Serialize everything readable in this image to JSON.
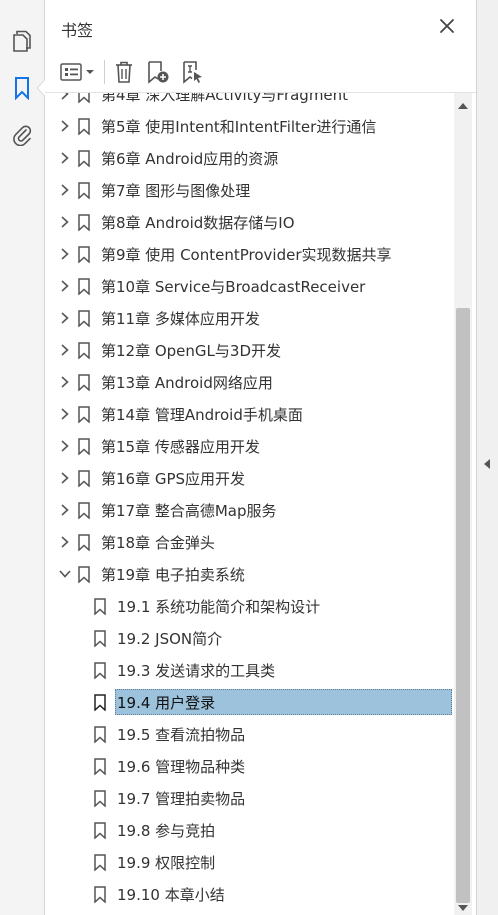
{
  "panel": {
    "title": "书签",
    "close_icon": "close-icon"
  },
  "rail": {
    "items": [
      {
        "icon": "pages-icon",
        "name": "pages"
      },
      {
        "icon": "bookmark-icon",
        "name": "bookmarks",
        "active": true
      },
      {
        "icon": "paperclip-icon",
        "name": "attachments"
      }
    ]
  },
  "toolbar": {
    "options_icon": "list-options-icon",
    "delete_icon": "trash-icon",
    "new_bookmark_icon": "new-bookmark-icon",
    "add_from_selection_icon": "bookmark-from-selection-icon"
  },
  "colors": {
    "accent": "#1473e6",
    "selection": "#9dc3dc",
    "text": "#333333"
  },
  "bookmarks": [
    {
      "label": "第4章 深入理解Activity与Fragment",
      "level": 1,
      "expanded": false
    },
    {
      "label": "第5章 使用Intent和IntentFilter进行通信",
      "level": 1,
      "expanded": false
    },
    {
      "label": "第6章 Android应用的资源",
      "level": 1,
      "expanded": false
    },
    {
      "label": "第7章 图形与图像处理",
      "level": 1,
      "expanded": false
    },
    {
      "label": "第8章 Android数据存储与IO",
      "level": 1,
      "expanded": false
    },
    {
      "label": "第9章 使用 ContentProvider实现数据共享",
      "level": 1,
      "expanded": false
    },
    {
      "label": "第10章 Service与BroadcastReceiver",
      "level": 1,
      "expanded": false
    },
    {
      "label": "第11章 多媒体应用开发",
      "level": 1,
      "expanded": false
    },
    {
      "label": "第12章 OpenGL与3D开发",
      "level": 1,
      "expanded": false
    },
    {
      "label": "第13章 Android网络应用",
      "level": 1,
      "expanded": false
    },
    {
      "label": "第14章 管理Android手机桌面",
      "level": 1,
      "expanded": false
    },
    {
      "label": "第15章 传感器应用开发",
      "level": 1,
      "expanded": false
    },
    {
      "label": "第16章 GPS应用开发",
      "level": 1,
      "expanded": false
    },
    {
      "label": "第17章 整合高德Map服务",
      "level": 1,
      "expanded": false
    },
    {
      "label": "第18章 合金弹头",
      "level": 1,
      "expanded": false
    },
    {
      "label": "第19章 电子拍卖系统",
      "level": 1,
      "expanded": true
    },
    {
      "label": "19.1 系统功能简介和架构设计",
      "level": 2
    },
    {
      "label": "19.2 JSON简介",
      "level": 2
    },
    {
      "label": "19.3 发送请求的工具类",
      "level": 2
    },
    {
      "label": "19.4 用户登录",
      "level": 2,
      "selected": true
    },
    {
      "label": "19.5 查看流拍物品",
      "level": 2
    },
    {
      "label": "19.6 管理物品种类",
      "level": 2
    },
    {
      "label": "19.7 管理拍卖物品",
      "level": 2
    },
    {
      "label": "19.8 参与竞拍",
      "level": 2
    },
    {
      "label": "19.9 权限控制",
      "level": 2
    },
    {
      "label": "19.10 本章小结",
      "level": 2
    }
  ]
}
